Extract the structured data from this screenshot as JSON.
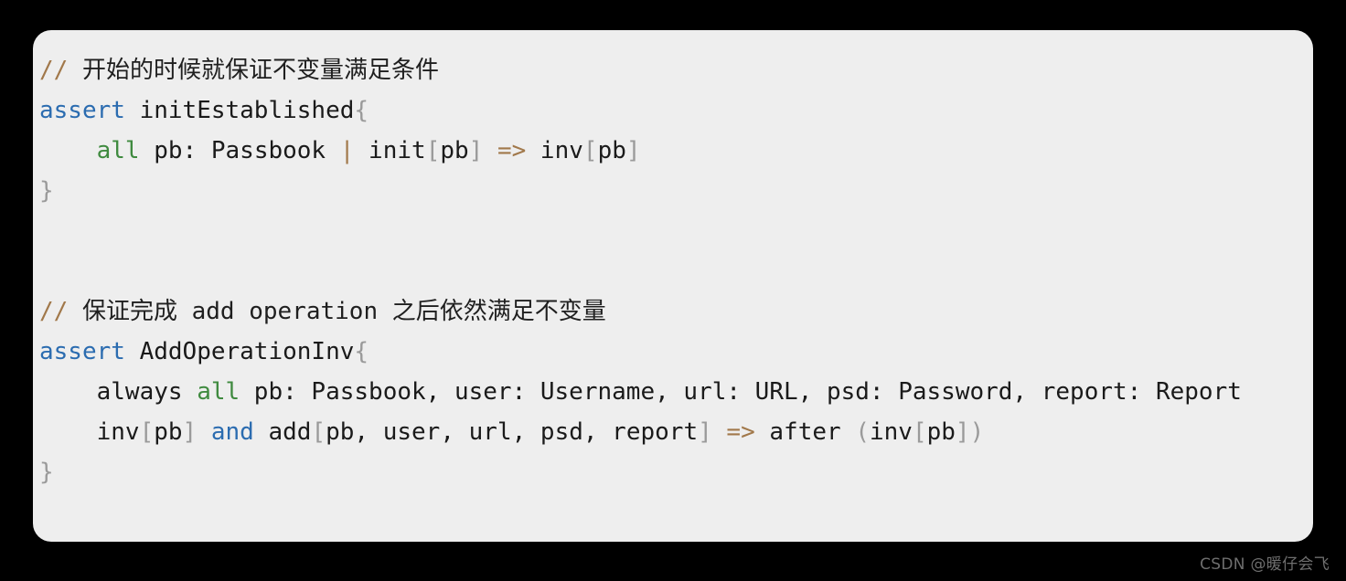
{
  "card": {
    "background": "#eeeeee",
    "page_background": "#000000",
    "corner_radius_px": 20
  },
  "colors": {
    "comment_slash": "#a1784a",
    "comment_text": "#1f1f1f",
    "keyword": "#2b6cb0",
    "quantifier": "#3f8a3f",
    "plain": "#1a1a1a",
    "punctuation": "#9a9a9a",
    "operator": "#a1784a"
  },
  "code": {
    "language": "alloy",
    "lines": [
      {
        "n": 1,
        "text": "// 开始的时候就保证不变量满足条件",
        "tokens": [
          {
            "t": "// ",
            "c": "comment_slash"
          },
          {
            "t": "开始的时候就保证不变量满足条件",
            "c": "comment_text"
          }
        ]
      },
      {
        "n": 2,
        "text": "assert initEstablished{",
        "tokens": [
          {
            "t": "assert",
            "c": "keyword"
          },
          {
            "t": " initEstablished",
            "c": "plain"
          },
          {
            "t": "{",
            "c": "punctuation"
          }
        ]
      },
      {
        "n": 3,
        "text": "    all pb: Passbook | init[pb] => inv[pb]",
        "tokens": [
          {
            "t": "    ",
            "c": "plain"
          },
          {
            "t": "all",
            "c": "quantifier"
          },
          {
            "t": " pb: Passbook ",
            "c": "plain"
          },
          {
            "t": "|",
            "c": "operator"
          },
          {
            "t": " init",
            "c": "plain"
          },
          {
            "t": "[",
            "c": "punctuation"
          },
          {
            "t": "pb",
            "c": "plain"
          },
          {
            "t": "]",
            "c": "punctuation"
          },
          {
            "t": " ",
            "c": "plain"
          },
          {
            "t": "=>",
            "c": "operator"
          },
          {
            "t": " inv",
            "c": "plain"
          },
          {
            "t": "[",
            "c": "punctuation"
          },
          {
            "t": "pb",
            "c": "plain"
          },
          {
            "t": "]",
            "c": "punctuation"
          }
        ]
      },
      {
        "n": 4,
        "text": "}",
        "tokens": [
          {
            "t": "}",
            "c": "punctuation"
          }
        ]
      },
      {
        "n": 5,
        "text": "",
        "tokens": []
      },
      {
        "n": 6,
        "text": "",
        "tokens": []
      },
      {
        "n": 7,
        "text": "// 保证完成 add operation 之后依然满足不变量",
        "tokens": [
          {
            "t": "// ",
            "c": "comment_slash"
          },
          {
            "t": "保证完成 add operation 之后依然满足不变量",
            "c": "comment_text"
          }
        ]
      },
      {
        "n": 8,
        "text": "assert AddOperationInv{",
        "tokens": [
          {
            "t": "assert",
            "c": "keyword"
          },
          {
            "t": " AddOperationInv",
            "c": "plain"
          },
          {
            "t": "{",
            "c": "punctuation"
          }
        ]
      },
      {
        "n": 9,
        "text": "    always all pb: Passbook, user: Username, url: URL, psd: Password, report: Report",
        "clipped": true,
        "visible_text": "    always all pb: Passbook, user: Username, url: URL, psd: Password, report: Repor",
        "tokens": [
          {
            "t": "    always ",
            "c": "plain"
          },
          {
            "t": "all",
            "c": "quantifier"
          },
          {
            "t": " pb: Passbook, user: Username, url: URL, psd: Password, report: Report",
            "c": "plain"
          }
        ]
      },
      {
        "n": 10,
        "text": "    inv[pb] and add[pb, user, url, psd, report] => after (inv[pb])",
        "tokens": [
          {
            "t": "    inv",
            "c": "plain"
          },
          {
            "t": "[",
            "c": "punctuation"
          },
          {
            "t": "pb",
            "c": "plain"
          },
          {
            "t": "]",
            "c": "punctuation"
          },
          {
            "t": " ",
            "c": "plain"
          },
          {
            "t": "and",
            "c": "keyword"
          },
          {
            "t": " add",
            "c": "plain"
          },
          {
            "t": "[",
            "c": "punctuation"
          },
          {
            "t": "pb, user, url, psd, report",
            "c": "plain"
          },
          {
            "t": "]",
            "c": "punctuation"
          },
          {
            "t": " ",
            "c": "plain"
          },
          {
            "t": "=>",
            "c": "operator"
          },
          {
            "t": " after ",
            "c": "plain"
          },
          {
            "t": "(",
            "c": "punctuation"
          },
          {
            "t": "inv",
            "c": "plain"
          },
          {
            "t": "[",
            "c": "punctuation"
          },
          {
            "t": "pb",
            "c": "plain"
          },
          {
            "t": "]",
            "c": "punctuation"
          },
          {
            "t": ")",
            "c": "punctuation"
          }
        ]
      },
      {
        "n": 11,
        "text": "}",
        "tokens": [
          {
            "t": "}",
            "c": "punctuation"
          }
        ]
      }
    ]
  },
  "watermark": {
    "text": "CSDN @暖仔会飞"
  }
}
